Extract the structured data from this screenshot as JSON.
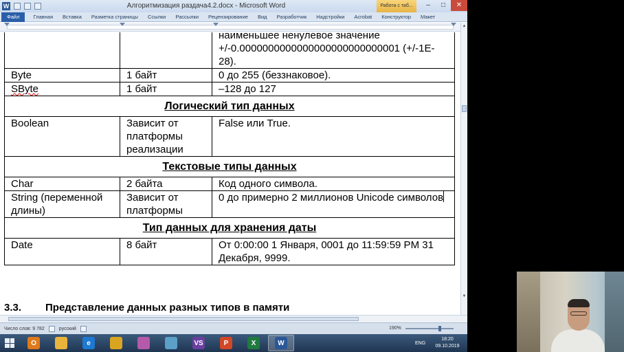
{
  "window": {
    "title": "Алгоритмизация раздача4.2.docx - Microsoft Word",
    "contextual_tab": "Работа с таб...",
    "app_icon": "W",
    "controls": {
      "minimize": "–",
      "maximize": "□",
      "close": "✕"
    }
  },
  "ribbon": {
    "tabs": [
      "Файл",
      "Главная",
      "Вставка",
      "Разметка страницы",
      "Ссылки",
      "Рассылки",
      "Рецензирование",
      "Вид",
      "Разработчик",
      "Надстройки",
      "Acrobat",
      "Конструктор",
      "Макет"
    ]
  },
  "document": {
    "rows": [
      {
        "type": "data",
        "c1": "",
        "c2": "",
        "c3": "наименьшее ненулевое значение +/-0.0000000000000000000000000001 (+/-1E-28)."
      },
      {
        "type": "data",
        "c1": "Byte",
        "c2": "1 байт",
        "c3": "0 до 255 (беззнаковое)."
      },
      {
        "type": "data",
        "c1": "SByte",
        "c2": "1 байт",
        "c3": "–128 до 127"
      },
      {
        "type": "section",
        "text": "Логический тип данных"
      },
      {
        "type": "data",
        "c1": "Boolean",
        "c2": "Зависит от платформы реализации",
        "c3": "False или True."
      },
      {
        "type": "section",
        "text": "Текстовые типы данных"
      },
      {
        "type": "data",
        "c1": "Char",
        "c2": "2 байта",
        "c3": "Код одного символа."
      },
      {
        "type": "data",
        "c1": "String (переменной длины)",
        "c2": "Зависит от платформы",
        "c3": "0 до примерно 2 миллионов Unicode символов"
      },
      {
        "type": "section",
        "text": "Тип данных для хранения даты"
      },
      {
        "type": "data",
        "c1": "Date",
        "c2": "8 байт",
        "c3": "От 0:00:00 1 Января, 0001 до 11:59:59 PM 31 Декабря, 9999."
      }
    ],
    "heading": {
      "number": "3.3.",
      "text": "Представление данных разных типов в памяти"
    }
  },
  "statusbar": {
    "word_count": "Число слов: 9 782",
    "language": "русский",
    "zoom": "190%"
  },
  "taskbar": {
    "language": "ENG",
    "time": "18:20",
    "date": "09.10.2019",
    "apps": [
      {
        "name": "outlook-icon",
        "glyph": "O",
        "color": "#e0791b"
      },
      {
        "name": "explorer-icon",
        "glyph": "",
        "color": "#e9b43c"
      },
      {
        "name": "ie-icon",
        "glyph": "e",
        "color": "#1d79d1"
      },
      {
        "name": "chrome-icon",
        "glyph": "",
        "color": "#d9a520"
      },
      {
        "name": "photos-icon",
        "glyph": "",
        "color": "#b45aa8"
      },
      {
        "name": "notes-icon",
        "glyph": "",
        "color": "#5aa0c8"
      },
      {
        "name": "visual-studio-icon",
        "glyph": "VS",
        "color": "#6a3fa0"
      },
      {
        "name": "powerpoint-icon",
        "glyph": "P",
        "color": "#d24726"
      },
      {
        "name": "excel-icon",
        "glyph": "X",
        "color": "#1f7a3f"
      },
      {
        "name": "word-icon",
        "glyph": "W",
        "color": "#2b5797"
      }
    ]
  }
}
